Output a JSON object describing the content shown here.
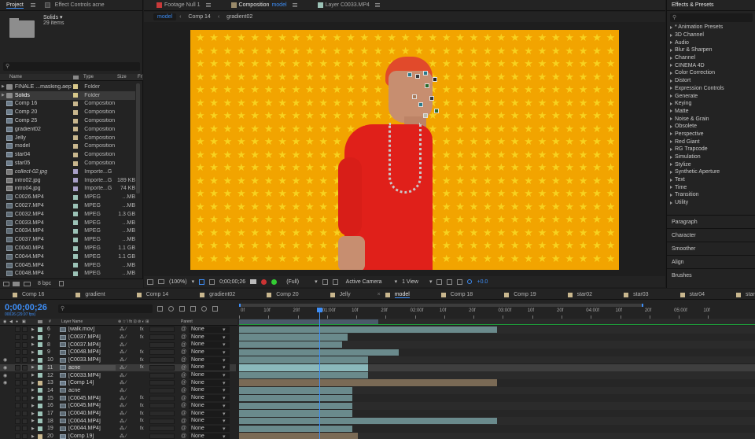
{
  "project": {
    "tab_project": "Project",
    "tab_effect_controls": "Effect Controls acne",
    "selected_name": "Solids ▾",
    "selected_count": "29 items",
    "col_name": "Name",
    "col_type": "Type",
    "col_size": "Size",
    "col_fr": "Fr",
    "bpc": "8 bpc",
    "items": [
      {
        "name": "FINALE ...masking.aep",
        "type": "Folder",
        "size": "",
        "icon": "folder",
        "label_color": "#d8c88a"
      },
      {
        "name": "Solids",
        "type": "Folder",
        "size": "",
        "icon": "folder",
        "label_color": "#d8c88a"
      },
      {
        "name": "Comp 16",
        "type": "Composition",
        "size": "",
        "icon": "comp",
        "label_color": "#c9b78e"
      },
      {
        "name": "Comp 20",
        "type": "Composition",
        "size": "",
        "icon": "comp",
        "label_color": "#c9b78e"
      },
      {
        "name": "Comp 25",
        "type": "Composition",
        "size": "",
        "icon": "comp",
        "label_color": "#c9b78e"
      },
      {
        "name": "gradient02",
        "type": "Composition",
        "size": "",
        "icon": "comp",
        "label_color": "#c9b78e"
      },
      {
        "name": "Jelly",
        "type": "Composition",
        "size": "",
        "icon": "comp",
        "label_color": "#c9b78e"
      },
      {
        "name": "model",
        "type": "Composition",
        "size": "",
        "icon": "comp",
        "label_color": "#c9b78e"
      },
      {
        "name": "star04",
        "type": "Composition",
        "size": "",
        "icon": "comp",
        "label_color": "#c9b78e"
      },
      {
        "name": "star05",
        "type": "Composition",
        "size": "",
        "icon": "comp",
        "label_color": "#c9b78e"
      },
      {
        "name": "collect-02.jpg",
        "type": "Importe...G",
        "size": "",
        "icon": "img",
        "label_color": "#a9a0c8"
      },
      {
        "name": "intro02.jpg",
        "type": "Importe...G",
        "size": "189 KB",
        "icon": "img",
        "label_color": "#a9a0c8"
      },
      {
        "name": "intro04.jpg",
        "type": "Importe...G",
        "size": "74 KB",
        "icon": "img",
        "label_color": "#a9a0c8"
      },
      {
        "name": "C0026.MP4",
        "type": "MPEG",
        "size": "...MB",
        "icon": "vid",
        "label_color": "#9cc3b7"
      },
      {
        "name": "C0027.MP4",
        "type": "MPEG",
        "size": "...MB",
        "icon": "vid",
        "label_color": "#9cc3b7"
      },
      {
        "name": "C0032.MP4",
        "type": "MPEG",
        "size": "1.3 GB",
        "icon": "vid",
        "label_color": "#9cc3b7"
      },
      {
        "name": "C0033.MP4",
        "type": "MPEG",
        "size": "...MB",
        "icon": "vid",
        "label_color": "#9cc3b7"
      },
      {
        "name": "C0034.MP4",
        "type": "MPEG",
        "size": "...MB",
        "icon": "vid",
        "label_color": "#9cc3b7"
      },
      {
        "name": "C0037.MP4",
        "type": "MPEG",
        "size": "...MB",
        "icon": "vid",
        "label_color": "#9cc3b7"
      },
      {
        "name": "C0040.MP4",
        "type": "MPEG",
        "size": "1.1 GB",
        "icon": "vid",
        "label_color": "#9cc3b7"
      },
      {
        "name": "C0044.MP4",
        "type": "MPEG",
        "size": "1.1 GB",
        "icon": "vid",
        "label_color": "#9cc3b7"
      },
      {
        "name": "C0045.MP4",
        "type": "MPEG",
        "size": "...MB",
        "icon": "vid",
        "label_color": "#9cc3b7"
      },
      {
        "name": "C0048.MP4",
        "type": "MPEG",
        "size": "...MB",
        "icon": "vid",
        "label_color": "#9cc3b7"
      }
    ]
  },
  "viewer": {
    "tabs": [
      {
        "label": "Footage Null 1",
        "color": "#c83a3a"
      },
      {
        "label": "Composition",
        "label_accent": "model",
        "color": "#9a8a6a"
      },
      {
        "label": "Layer C0033.MP4",
        "color": "#9cc3b7"
      }
    ],
    "breadcrumbs": [
      "model",
      "Comp 14",
      "gradient02"
    ],
    "zoom": "(100%)",
    "timecode": "0;00;00;26",
    "resolution": "(Full)",
    "camera": "Active Camera",
    "view": "1 View",
    "exposure": "+0.0",
    "bg_color": "#f2a400",
    "star_color": "#f7d21f"
  },
  "effects": {
    "title": "Effects & Presets",
    "search_placeholder": "",
    "categories": [
      "* Animation Presets",
      "3D Channel",
      "Audio",
      "Blur & Sharpen",
      "Channel",
      "CINEMA 4D",
      "Color Correction",
      "Distort",
      "Expression Controls",
      "Generate",
      "Keying",
      "Matte",
      "Noise & Grain",
      "Obsolete",
      "Perspective",
      "Red Giant",
      "RG Trapcode",
      "Simulation",
      "Stylize",
      "Synthetic Aperture",
      "Text",
      "Time",
      "Transition",
      "Utility"
    ],
    "panels": [
      "Paragraph",
      "Character",
      "Smoother",
      "Align",
      "Brushes"
    ]
  },
  "timeline": {
    "tabs": [
      {
        "label": "Comp 16",
        "color": "#c9b78e"
      },
      {
        "label": "gradient",
        "color": "#c9b78e"
      },
      {
        "label": "Comp 14",
        "color": "#c9b78e"
      },
      {
        "label": "gradient02",
        "color": "#c9b78e"
      },
      {
        "label": "Comp 20",
        "color": "#c9b78e"
      },
      {
        "label": "Jelly",
        "color": "#c9b78e"
      },
      {
        "label": "model",
        "color": "#c9b78e",
        "active": true
      },
      {
        "label": "Comp 18",
        "color": "#c9b78e"
      },
      {
        "label": "Comp 19",
        "color": "#c9b78e"
      },
      {
        "label": "star02",
        "color": "#c9b78e"
      },
      {
        "label": "star03",
        "color": "#c9b78e"
      },
      {
        "label": "star04",
        "color": "#c9b78e"
      },
      {
        "label": "star05",
        "color": "#c9b78e"
      },
      {
        "label": "stars",
        "color": "#c9b78e"
      },
      {
        "label": "Renc",
        "color": "#c9b78e"
      }
    ],
    "timecode": "0;00;00;26",
    "frame_info": "00026 (29.97 fps)",
    "col_layer_name": "Layer Name",
    "col_parent": "Parent",
    "ruler": [
      "0f",
      "10f",
      "20f",
      "01:00f",
      "10f",
      "20f",
      "02:00f",
      "10f",
      "20f",
      "03:00f",
      "10f",
      "20f",
      "04:00f",
      "10f",
      "20f",
      "05:00f",
      "10f"
    ],
    "layers": [
      {
        "num": "6",
        "name": "[walk.mov]",
        "parent": "None",
        "label_color": "#9cc3b7",
        "eye": false,
        "fx": true,
        "bar_start": 0.0,
        "bar_end": 0.5
      },
      {
        "num": "7",
        "name": "[C0037.MP4]",
        "parent": "None",
        "label_color": "#9cc3b7",
        "eye": false,
        "fx": true,
        "bar_start": 0.0,
        "bar_end": 0.21
      },
      {
        "num": "8",
        "name": "[C0037.MP4]",
        "parent": "None",
        "label_color": "#9cc3b7",
        "eye": false,
        "fx": false,
        "bar_start": 0.0,
        "bar_end": 0.2
      },
      {
        "num": "9",
        "name": "[C0048.MP4]",
        "parent": "None",
        "label_color": "#9cc3b7",
        "eye": false,
        "fx": true,
        "bar_start": 0.0,
        "bar_end": 0.31
      },
      {
        "num": "10",
        "name": "[C0033.MP4]",
        "parent": "None",
        "label_color": "#9cc3b7",
        "eye": true,
        "fx": true,
        "bar_start": 0.0,
        "bar_end": 0.25
      },
      {
        "num": "11",
        "name": "acne",
        "parent": "None",
        "label_color": "#9cc3b7",
        "eye": true,
        "fx": true,
        "bar_start": 0.0,
        "bar_end": 0.25,
        "selected": true
      },
      {
        "num": "12",
        "name": "[C0033.MP4]",
        "parent": "None",
        "label_color": "#9cc3b7",
        "eye": true,
        "fx": false,
        "bar_start": 0.0,
        "bar_end": 0.25
      },
      {
        "num": "13",
        "name": "[Comp 14]",
        "parent": "None",
        "label_color": "#c9b78e",
        "eye": true,
        "fx": false,
        "bar_start": 0.0,
        "bar_end": 0.5,
        "comp": true
      },
      {
        "num": "14",
        "name": "acne",
        "parent": "None",
        "label_color": "#9cc3b7",
        "eye": false,
        "fx": false,
        "bar_start": 0.0,
        "bar_end": 0.22
      },
      {
        "num": "15",
        "name": "[C0045.MP4]",
        "parent": "None",
        "label_color": "#9cc3b7",
        "eye": false,
        "fx": true,
        "bar_start": 0.0,
        "bar_end": 0.22
      },
      {
        "num": "16",
        "name": "[C0045.MP4]",
        "parent": "None",
        "label_color": "#9cc3b7",
        "eye": false,
        "fx": true,
        "bar_start": 0.0,
        "bar_end": 0.22
      },
      {
        "num": "17",
        "name": "[C0040.MP4]",
        "parent": "None",
        "label_color": "#9cc3b7",
        "eye": false,
        "fx": true,
        "bar_start": 0.0,
        "bar_end": 0.22
      },
      {
        "num": "18",
        "name": "[C0044.MP4]",
        "parent": "None",
        "label_color": "#9cc3b7",
        "eye": false,
        "fx": true,
        "bar_start": 0.0,
        "bar_end": 0.5
      },
      {
        "num": "19",
        "name": "[C0044.MP4]",
        "parent": "None",
        "label_color": "#9cc3b7",
        "eye": false,
        "fx": true,
        "bar_start": 0.0,
        "bar_end": 0.22
      },
      {
        "num": "20",
        "name": "[Comp 19]",
        "parent": "None",
        "label_color": "#c9b78e",
        "eye": false,
        "fx": false,
        "bar_start": 0.0,
        "bar_end": 0.23,
        "comp": true
      }
    ],
    "playhead": 0.155,
    "work_area_end": 0.27
  }
}
